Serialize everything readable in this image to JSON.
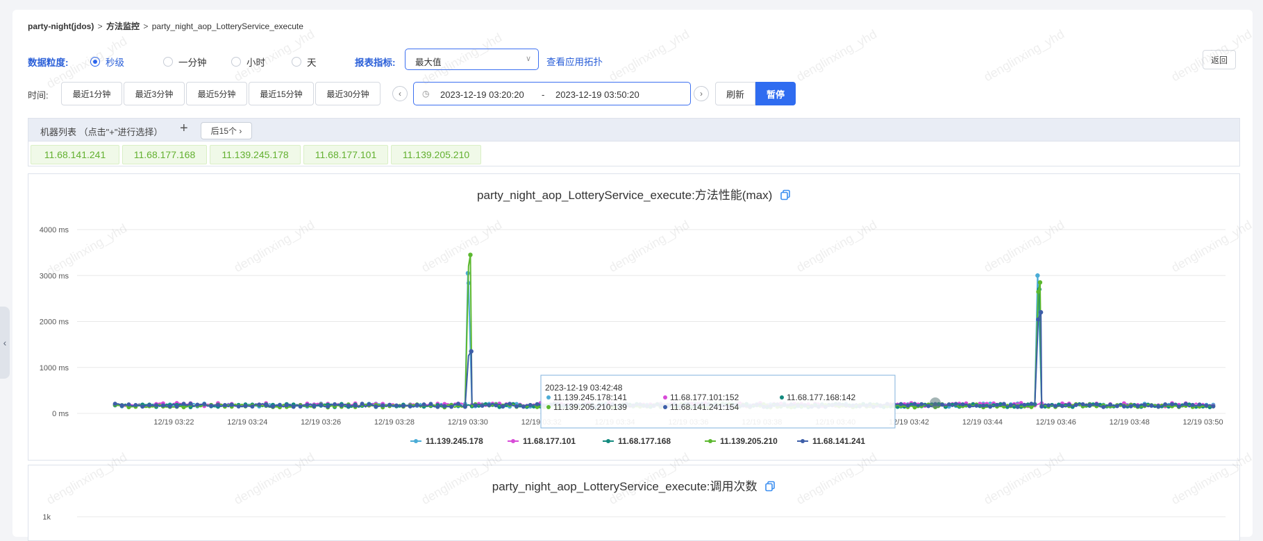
{
  "breadcrumb": {
    "app": "party-night(jdos)",
    "section": "方法监控",
    "method": "party_night_aop_LotteryService_execute"
  },
  "granularity": {
    "label": "数据粒度:",
    "options": [
      {
        "label": "秒级",
        "selected": true
      },
      {
        "label": "一分钟",
        "selected": false
      },
      {
        "label": "小时",
        "selected": false
      },
      {
        "label": "天",
        "selected": false
      }
    ]
  },
  "metric": {
    "label": "报表指标:",
    "value": "最大值",
    "link": "查看应用拓扑"
  },
  "back_label": "返回",
  "time": {
    "label": "时间:",
    "quick": [
      "最近1分钟",
      "最近3分钟",
      "最近5分钟",
      "最近15分钟",
      "最近30分钟"
    ],
    "start": "2023-12-19 03:20:20",
    "dash": "-",
    "end": "2023-12-19 03:50:20",
    "refresh": "刷新",
    "pause": "暂停"
  },
  "machines": {
    "title": "机器列表 （点击\"+\"进行选择）",
    "plus": "+",
    "next": "后15个",
    "ips": [
      "11.68.141.241",
      "11.68.177.168",
      "11.139.245.178",
      "11.68.177.101",
      "11.139.205.210"
    ]
  },
  "colors": {
    "c1": "#4bacd6",
    "c2": "#d84bd8",
    "c3": "#138a7e",
    "c4": "#5cb82f",
    "c5": "#3d5ea8",
    "accent": "#2f6cf0"
  },
  "watermark": "denglinxing_yhd",
  "chart_data": [
    {
      "type": "line",
      "title": "party_night_aop_LotteryService_execute:方法性能(max)",
      "ylim": [
        0,
        4000
      ],
      "yticks": [
        "0 ms",
        "1000 ms",
        "2000 ms",
        "3000 ms",
        "4000 ms"
      ],
      "xticks": [
        "12/19 03:22",
        "12/19 03:24",
        "12/19 03:26",
        "12/19 03:28",
        "12/19 03:30",
        "12/19 03:32",
        "12/19 03:34",
        "12/19 03:36",
        "12/19 03:38",
        "12/19 03:40",
        "12/19 03:42",
        "12/19 03:44",
        "12/19 03:46",
        "12/19 03:48",
        "12/19 03:50"
      ],
      "series": [
        {
          "name": "11.139.245.178",
          "baseline": 180,
          "spikes": [
            {
              "t": "03:30",
              "v": 3050
            },
            {
              "t": "03:45:30",
              "v": 3000
            }
          ]
        },
        {
          "name": "11.68.177.101",
          "baseline": 190,
          "spikes": []
        },
        {
          "name": "11.68.177.168",
          "baseline": 170,
          "spikes": [
            {
              "t": "03:45:30",
              "v": 2700
            }
          ]
        },
        {
          "name": "11.139.205.210",
          "baseline": 165,
          "spikes": [
            {
              "t": "03:30",
              "v": 3450
            },
            {
              "t": "03:45:30",
              "v": 2850
            }
          ]
        },
        {
          "name": "11.68.141.241",
          "baseline": 175,
          "spikes": [
            {
              "t": "03:30",
              "v": 1350
            },
            {
              "t": "03:45:30",
              "v": 2200
            }
          ]
        }
      ],
      "tooltip": {
        "time": "2023-12-19 03:42:48",
        "items": [
          "11.139.245.178:141",
          "11.68.177.101:152",
          "11.68.177.168:142",
          "11.139.205.210:139",
          "11.68.141.241:154"
        ]
      },
      "legend": "bottom"
    },
    {
      "type": "line",
      "title": "party_night_aop_LotteryService_execute:调用次数",
      "yticks": [
        "1k"
      ]
    }
  ]
}
